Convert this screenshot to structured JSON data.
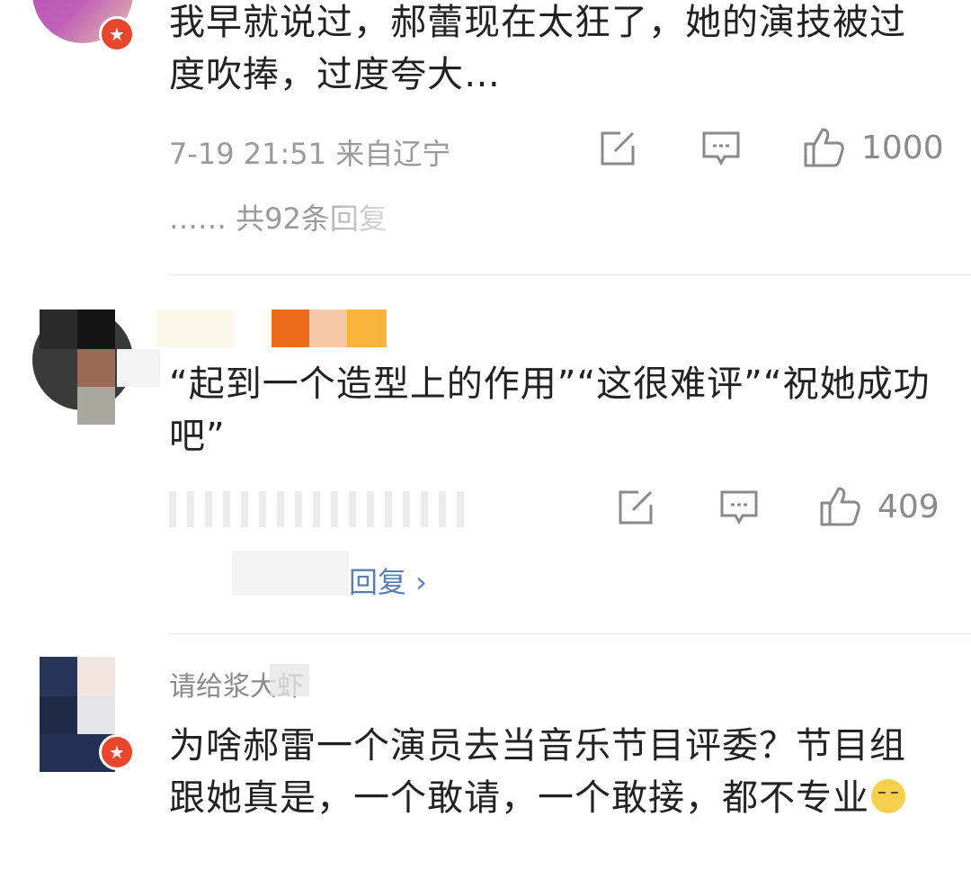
{
  "comments": [
    {
      "text": "我早就说过，郝蕾现在太狂了，她的演技被过度吹捧，过度夸大…",
      "time_location": "7-19 21:51 来自辽宁",
      "likes": "1000",
      "replies": "…… 共92条回复"
    },
    {
      "text": "“起到一个造型上的作用”“这很难评”“祝她成功吧”",
      "likes": "409",
      "replies_partial": "回复 ›"
    },
    {
      "username": "请给浆大虾",
      "text": "为啥郝雷一个演员去当音乐节目评委？节目组跟她真是，一个敢请，一个敢接，都不专业"
    }
  ],
  "icons": {
    "edit": "share-edit-icon",
    "comment": "comment-icon",
    "like": "thumb-up-icon",
    "badge": "verified-star-badge-icon"
  },
  "colors": {
    "badge": "#e8472d",
    "reply_link": "#5a7fb5",
    "meta": "#9a9a9a"
  }
}
